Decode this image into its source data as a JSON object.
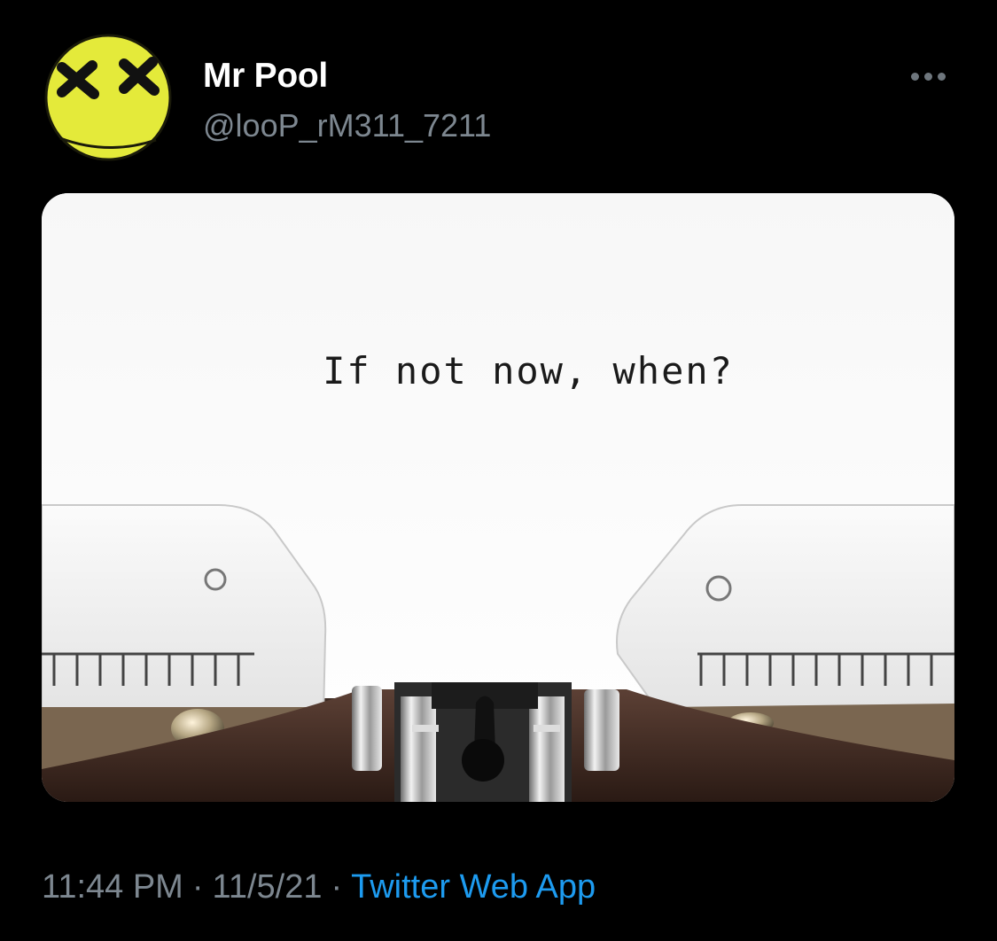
{
  "tweet": {
    "author": {
      "display_name": "Mr Pool",
      "handle": "@looP_rM311_7211",
      "avatar_icon": "yellow-smiley-face-avatar"
    },
    "more_icon": "more-options-icon",
    "media": {
      "typed_text": "If not now, when?"
    },
    "time": "11:44 PM",
    "separator": "·",
    "date": "11/5/21",
    "source": "Twitter Web App"
  },
  "colors": {
    "background": "#000000",
    "text_primary": "#ffffff",
    "text_secondary": "#7d8790",
    "link": "#1d9bf0",
    "avatar_yellow": "#e6ec3c"
  }
}
